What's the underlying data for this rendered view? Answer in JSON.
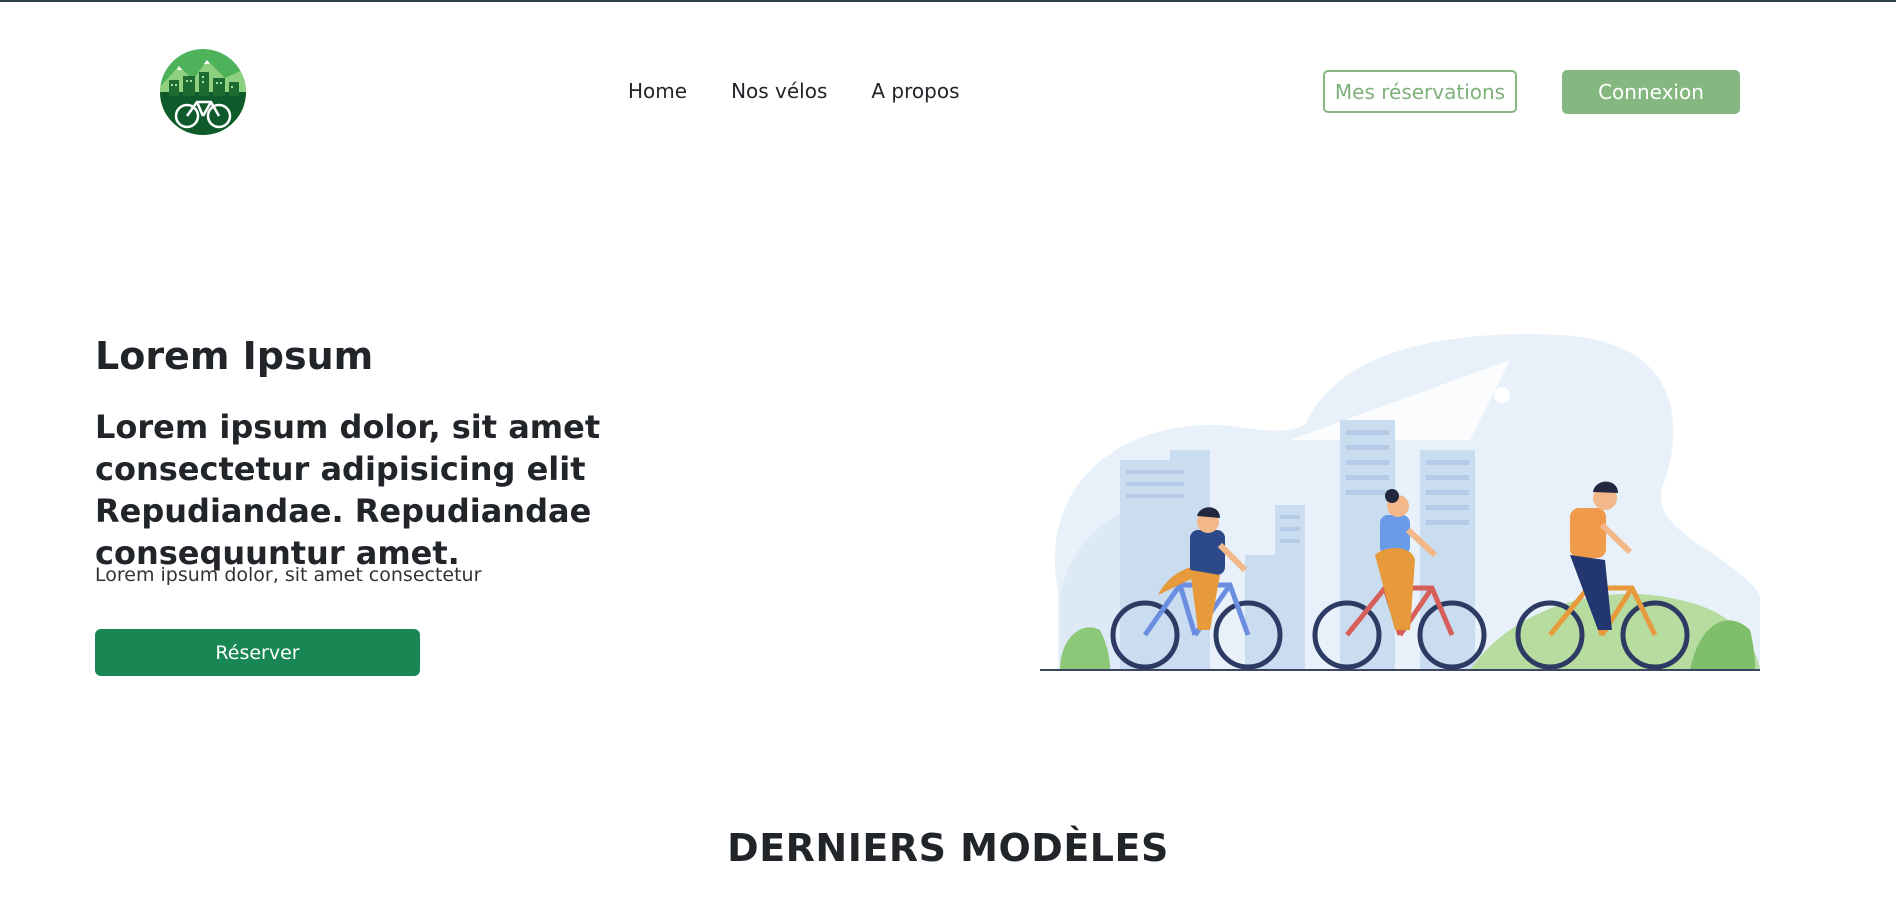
{
  "header": {
    "logo_icon": "bike-city-logo",
    "nav": [
      "Home",
      "Nos vélos",
      "A propos"
    ],
    "reservations_label": "Mes réservations",
    "login_label": "Connexion"
  },
  "hero": {
    "title": "Lorem Ipsum",
    "lead": "Lorem ipsum dolor, sit amet consectetur adipisicing elit Repudiandae. Repudiandae consequuntur amet.",
    "text": "Lorem ipsum dolor, sit amet consectetur",
    "cta_label": "Réserver",
    "illustration": "cyclists-in-city-illustration"
  },
  "section": {
    "title": "DERNIERS MODÈLES"
  },
  "colors": {
    "brand_green": "#198754",
    "soft_green": "#84b880",
    "text_dark": "#212529"
  }
}
